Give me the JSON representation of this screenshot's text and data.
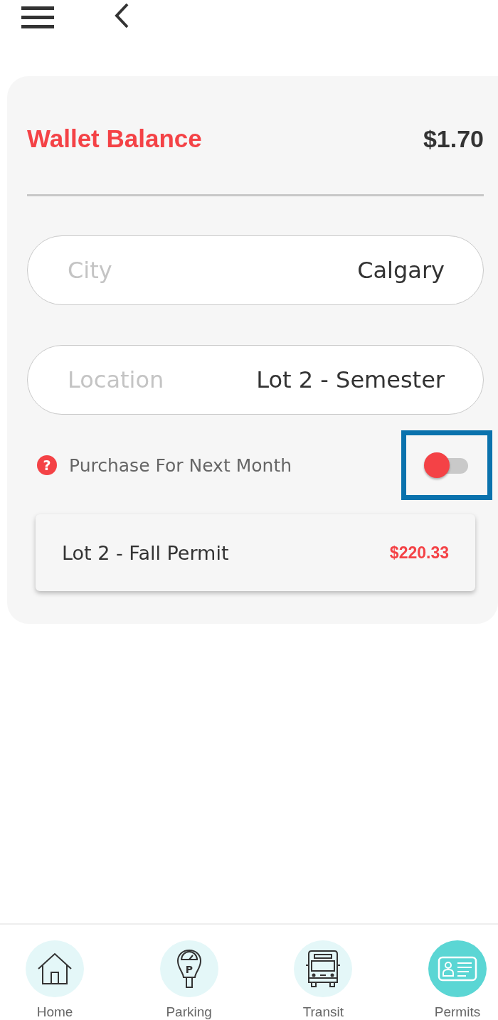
{
  "wallet": {
    "title": "Wallet Balance",
    "balance": "$1.70"
  },
  "fields": [
    {
      "label": "City",
      "value": "Calgary"
    },
    {
      "label": "Location",
      "value": "Lot 2 - Semester"
    }
  ],
  "next_month": {
    "help": "?",
    "label": "Purchase For Next Month",
    "on": false,
    "highlighted": true
  },
  "permits": [
    {
      "name": "Lot 2 - Fall Permit",
      "price": "$220.33"
    }
  ],
  "nav": [
    {
      "kind": "home",
      "label": "Home",
      "selected": false
    },
    {
      "kind": "parking",
      "label": "Parking",
      "glyph": "P",
      "selected": false
    },
    {
      "kind": "transit",
      "label": "Transit",
      "selected": false
    },
    {
      "kind": "permits",
      "label": "Permits",
      "selected": true
    }
  ]
}
